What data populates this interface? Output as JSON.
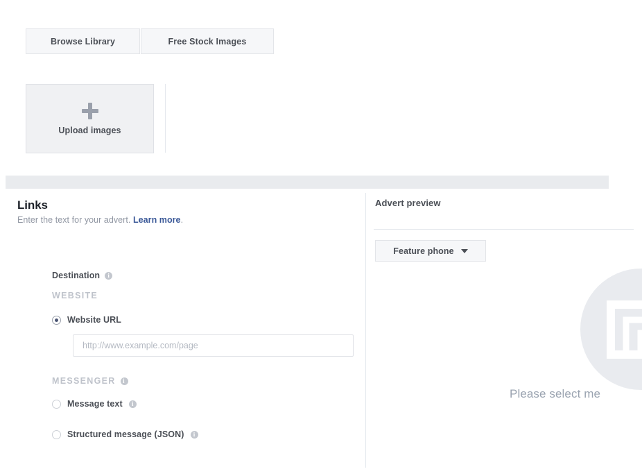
{
  "media": {
    "tabs": [
      {
        "label": "Browse Library",
        "name": "browse-library"
      },
      {
        "label": "Free Stock Images",
        "name": "free-stock-images"
      }
    ],
    "upload": {
      "label": "Upload images",
      "icon": "plus-icon"
    }
  },
  "links": {
    "title": "Links",
    "subtitle_before": "Enter the text for your advert. ",
    "learn_more": "Learn more",
    "subtitle_after": ".",
    "destination": {
      "label": "Destination",
      "info_icon": "info-icon"
    },
    "website": {
      "caption": "WEBSITE",
      "radio_label": "Website URL",
      "radio_selected": true,
      "url_placeholder": "http://www.example.com/page",
      "url_value": ""
    },
    "messenger": {
      "caption": "MESSENGER",
      "caption_info_icon": "info-icon",
      "options": [
        {
          "label": "Message text",
          "selected": false,
          "info_icon": "info-icon"
        },
        {
          "label": "Structured message (JSON)",
          "selected": false,
          "info_icon": "info-icon"
        }
      ]
    }
  },
  "preview": {
    "title": "Advert preview",
    "device": {
      "selected": "Feature phone",
      "caret_icon": "chevron-down-icon"
    },
    "placeholder_icon": "image-placeholder-icon",
    "message": "Please select me"
  },
  "colors": {
    "link_blue": "#3b5998",
    "band_gray": "#e9ebee",
    "button_gray": "#f6f7f9",
    "border_gray": "#e3e5e9",
    "text_dark": "#4b4f56",
    "text_muted": "#9197a3",
    "caption_gray": "#bfc3cb"
  }
}
